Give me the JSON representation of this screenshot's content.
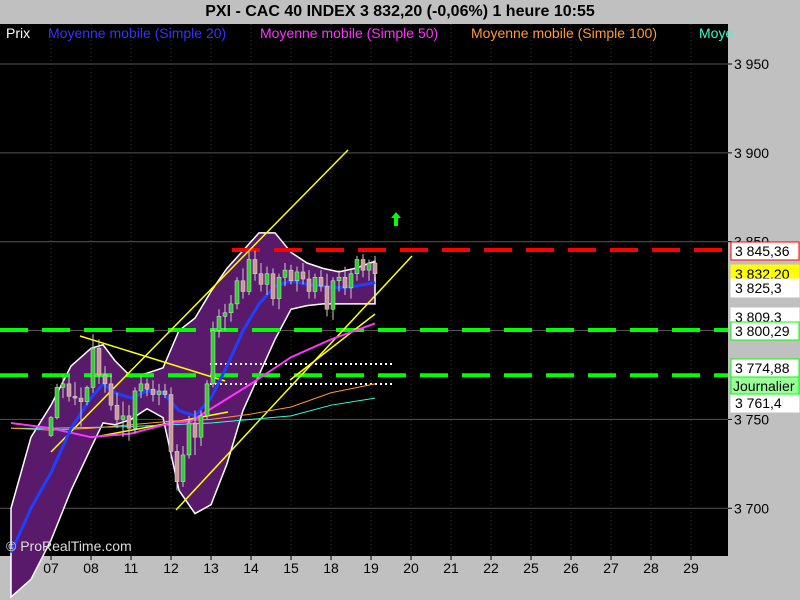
{
  "header": {
    "title": "PXI - CAC 40 INDEX     3 832,20 (-0,06%)     1 heure  10:55"
  },
  "legend": {
    "items": [
      {
        "label": "Prix",
        "color": "#ffffff"
      },
      {
        "label": "Moyenne mobile (Simple 20)",
        "color": "#3333ff"
      },
      {
        "label": "Moyenne mobile (Simple 50)",
        "color": "#ff33ff"
      },
      {
        "label": "Moyenne mobile (Simple 100)",
        "color": "#ff9933"
      },
      {
        "label": "Moye",
        "color": "#33ffcc"
      }
    ]
  },
  "watermark": "© ProRealTime.com",
  "chart_data": {
    "type": "candlestick",
    "x_ticks": [
      "07",
      "08",
      "11",
      "12",
      "13",
      "14",
      "15",
      "18",
      "19",
      "20",
      "21",
      "22",
      "25",
      "26",
      "27",
      "28",
      "29"
    ],
    "y_ticks": [
      {
        "value": 3950,
        "label": "3 950"
      },
      {
        "value": 3900,
        "label": "3 900"
      },
      {
        "value": 3850,
        "label": "3 850"
      },
      {
        "value": 3750,
        "label": "3 750"
      },
      {
        "value": 3700,
        "label": "3 700"
      }
    ],
    "ylim": [
      3680,
      3970
    ],
    "price_labels": [
      {
        "label": "3 845,36",
        "value": 3845.36,
        "bg": "#ffffff",
        "color": "#000000",
        "border": "#ff0000"
      },
      {
        "label": "3 832,20",
        "value": 3832.2,
        "bg": "#ffff00",
        "color": "#000000",
        "border": "#ffff00"
      },
      {
        "label": "3 825,3",
        "value": 3825.3,
        "bg": "#ffffff",
        "color": "#000000",
        "border": "#ffffff"
      },
      {
        "label": "3 809,3",
        "value": 3809.3,
        "bg": "#ffffff",
        "color": "#000000",
        "border": "#ffffff"
      },
      {
        "label": "3 800,29",
        "value": 3800.29,
        "bg": "#ffffff",
        "color": "#000000",
        "border": "#00ff00"
      },
      {
        "label": "3 774,88",
        "value": 3774.88,
        "bg": "#ffffff",
        "color": "#000000",
        "border": "#00ff00"
      },
      {
        "label": "3 761,4",
        "value": 3761.4,
        "bg": "#ffffff",
        "color": "#000000",
        "border": "#ffffff"
      }
    ],
    "timeframe_badge": "Journalier",
    "levels": [
      {
        "value": 3845.36,
        "color": "#ff0000",
        "style": "dashed"
      },
      {
        "value": 3800.29,
        "color": "#00ff00",
        "style": "dashed"
      },
      {
        "value": 3774.88,
        "color": "#00ff00",
        "style": "dashed"
      }
    ],
    "candles": [
      {
        "x": 0.0,
        "o": 3741,
        "h": 3752,
        "l": 3740,
        "c": 3751
      },
      {
        "x": 0.15,
        "o": 3751,
        "h": 3770,
        "l": 3750,
        "c": 3768
      },
      {
        "x": 0.3,
        "o": 3768,
        "h": 3775,
        "l": 3762,
        "c": 3770
      },
      {
        "x": 0.45,
        "o": 3770,
        "h": 3774,
        "l": 3760,
        "c": 3763
      },
      {
        "x": 0.6,
        "o": 3763,
        "h": 3771,
        "l": 3758,
        "c": 3762
      },
      {
        "x": 0.75,
        "o": 3762,
        "h": 3768,
        "l": 3746,
        "c": 3760
      },
      {
        "x": 0.9,
        "o": 3760,
        "h": 3769,
        "l": 3758,
        "c": 3768
      },
      {
        "x": 1.05,
        "o": 3768,
        "h": 3798,
        "l": 3765,
        "c": 3790
      },
      {
        "x": 1.2,
        "o": 3790,
        "h": 3795,
        "l": 3770,
        "c": 3775
      },
      {
        "x": 1.35,
        "o": 3775,
        "h": 3780,
        "l": 3765,
        "c": 3770
      },
      {
        "x": 1.5,
        "o": 3770,
        "h": 3775,
        "l": 3755,
        "c": 3758
      },
      {
        "x": 1.65,
        "o": 3758,
        "h": 3765,
        "l": 3745,
        "c": 3750
      },
      {
        "x": 1.8,
        "o": 3750,
        "h": 3760,
        "l": 3740,
        "c": 3752
      },
      {
        "x": 1.95,
        "o": 3752,
        "h": 3758,
        "l": 3738,
        "c": 3745
      },
      {
        "x": 2.1,
        "o": 3745,
        "h": 3768,
        "l": 3742,
        "c": 3766
      },
      {
        "x": 2.25,
        "o": 3766,
        "h": 3775,
        "l": 3762,
        "c": 3770
      },
      {
        "x": 2.4,
        "o": 3770,
        "h": 3773,
        "l": 3763,
        "c": 3767
      },
      {
        "x": 2.55,
        "o": 3767,
        "h": 3772,
        "l": 3760,
        "c": 3764
      },
      {
        "x": 2.7,
        "o": 3764,
        "h": 3770,
        "l": 3758,
        "c": 3766
      },
      {
        "x": 2.85,
        "o": 3766,
        "h": 3770,
        "l": 3762,
        "c": 3764
      },
      {
        "x": 3.0,
        "o": 3764,
        "h": 3768,
        "l": 3728,
        "c": 3732
      },
      {
        "x": 3.15,
        "o": 3732,
        "h": 3736,
        "l": 3710,
        "c": 3715
      },
      {
        "x": 3.3,
        "o": 3715,
        "h": 3735,
        "l": 3712,
        "c": 3730
      },
      {
        "x": 3.45,
        "o": 3730,
        "h": 3752,
        "l": 3728,
        "c": 3748
      },
      {
        "x": 3.6,
        "o": 3748,
        "h": 3755,
        "l": 3730,
        "c": 3740
      },
      {
        "x": 3.75,
        "o": 3740,
        "h": 3755,
        "l": 3735,
        "c": 3752
      },
      {
        "x": 3.9,
        "o": 3752,
        "h": 3772,
        "l": 3750,
        "c": 3770
      },
      {
        "x": 4.05,
        "o": 3770,
        "h": 3805,
        "l": 3768,
        "c": 3800
      },
      {
        "x": 4.2,
        "o": 3800,
        "h": 3812,
        "l": 3796,
        "c": 3808
      },
      {
        "x": 4.35,
        "o": 3808,
        "h": 3815,
        "l": 3800,
        "c": 3810
      },
      {
        "x": 4.5,
        "o": 3810,
        "h": 3820,
        "l": 3805,
        "c": 3815
      },
      {
        "x": 4.65,
        "o": 3815,
        "h": 3830,
        "l": 3812,
        "c": 3828
      },
      {
        "x": 4.8,
        "o": 3828,
        "h": 3835,
        "l": 3818,
        "c": 3822
      },
      {
        "x": 4.95,
        "o": 3822,
        "h": 3845,
        "l": 3820,
        "c": 3840
      },
      {
        "x": 5.1,
        "o": 3840,
        "h": 3845,
        "l": 3828,
        "c": 3832
      },
      {
        "x": 5.25,
        "o": 3832,
        "h": 3838,
        "l": 3822,
        "c": 3826
      },
      {
        "x": 5.4,
        "o": 3826,
        "h": 3836,
        "l": 3820,
        "c": 3832
      },
      {
        "x": 5.55,
        "o": 3832,
        "h": 3835,
        "l": 3814,
        "c": 3818
      },
      {
        "x": 5.7,
        "o": 3818,
        "h": 3832,
        "l": 3812,
        "c": 3830
      },
      {
        "x": 5.85,
        "o": 3830,
        "h": 3838,
        "l": 3825,
        "c": 3834
      },
      {
        "x": 6.0,
        "o": 3834,
        "h": 3837,
        "l": 3826,
        "c": 3828
      },
      {
        "x": 6.15,
        "o": 3828,
        "h": 3836,
        "l": 3822,
        "c": 3833
      },
      {
        "x": 6.3,
        "o": 3833,
        "h": 3838,
        "l": 3826,
        "c": 3829
      },
      {
        "x": 6.45,
        "o": 3829,
        "h": 3834,
        "l": 3818,
        "c": 3822
      },
      {
        "x": 6.6,
        "o": 3822,
        "h": 3832,
        "l": 3818,
        "c": 3830
      },
      {
        "x": 6.75,
        "o": 3830,
        "h": 3834,
        "l": 3822,
        "c": 3825
      },
      {
        "x": 6.9,
        "o": 3825,
        "h": 3832,
        "l": 3808,
        "c": 3812
      },
      {
        "x": 7.05,
        "o": 3812,
        "h": 3830,
        "l": 3806,
        "c": 3828
      },
      {
        "x": 7.2,
        "o": 3828,
        "h": 3834,
        "l": 3822,
        "c": 3830
      },
      {
        "x": 7.35,
        "o": 3830,
        "h": 3836,
        "l": 3820,
        "c": 3824
      },
      {
        "x": 7.5,
        "o": 3824,
        "h": 3834,
        "l": 3818,
        "c": 3832
      },
      {
        "x": 7.65,
        "o": 3832,
        "h": 3842,
        "l": 3828,
        "c": 3840
      },
      {
        "x": 7.8,
        "o": 3840,
        "h": 3843,
        "l": 3830,
        "c": 3834
      },
      {
        "x": 7.95,
        "o": 3834,
        "h": 3840,
        "l": 3828,
        "c": 3838
      },
      {
        "x": 8.1,
        "o": 3838,
        "h": 3842,
        "l": 3830,
        "c": 3832
      }
    ],
    "ma20": [
      [
        -1,
        3675
      ],
      [
        -0.5,
        3700
      ],
      [
        0,
        3720
      ],
      [
        0.5,
        3745
      ],
      [
        1,
        3762
      ],
      [
        1.3,
        3770
      ],
      [
        1.6,
        3765
      ],
      [
        2,
        3762
      ],
      [
        2.4,
        3766
      ],
      [
        2.8,
        3765
      ],
      [
        3.2,
        3755
      ],
      [
        3.6,
        3752
      ],
      [
        4,
        3762
      ],
      [
        4.4,
        3780
      ],
      [
        4.8,
        3800
      ],
      [
        5.2,
        3815
      ],
      [
        5.6,
        3825
      ],
      [
        6,
        3828
      ],
      [
        6.4,
        3826
      ],
      [
        6.8,
        3825
      ],
      [
        7.2,
        3824
      ],
      [
        7.6,
        3825
      ],
      [
        8.1,
        3827
      ]
    ],
    "ma50": [
      [
        -1,
        3748
      ],
      [
        0,
        3745
      ],
      [
        1,
        3740
      ],
      [
        2,
        3742
      ],
      [
        3,
        3748
      ],
      [
        3.5,
        3749
      ],
      [
        4,
        3756
      ],
      [
        5,
        3770
      ],
      [
        6,
        3785
      ],
      [
        7,
        3795
      ],
      [
        8.1,
        3804
      ]
    ],
    "ma100": [
      [
        -1,
        3745
      ],
      [
        0,
        3744
      ],
      [
        1,
        3745
      ],
      [
        2,
        3747
      ],
      [
        3,
        3749
      ],
      [
        4,
        3750
      ],
      [
        5,
        3753
      ],
      [
        6,
        3757
      ],
      [
        7,
        3765
      ],
      [
        8.1,
        3770
      ]
    ],
    "ma200": [
      [
        -1,
        3745
      ],
      [
        0,
        3745
      ],
      [
        2,
        3746
      ],
      [
        4,
        3748
      ],
      [
        5,
        3750
      ],
      [
        6,
        3752
      ],
      [
        7,
        3758
      ],
      [
        8.1,
        3762
      ]
    ]
  }
}
